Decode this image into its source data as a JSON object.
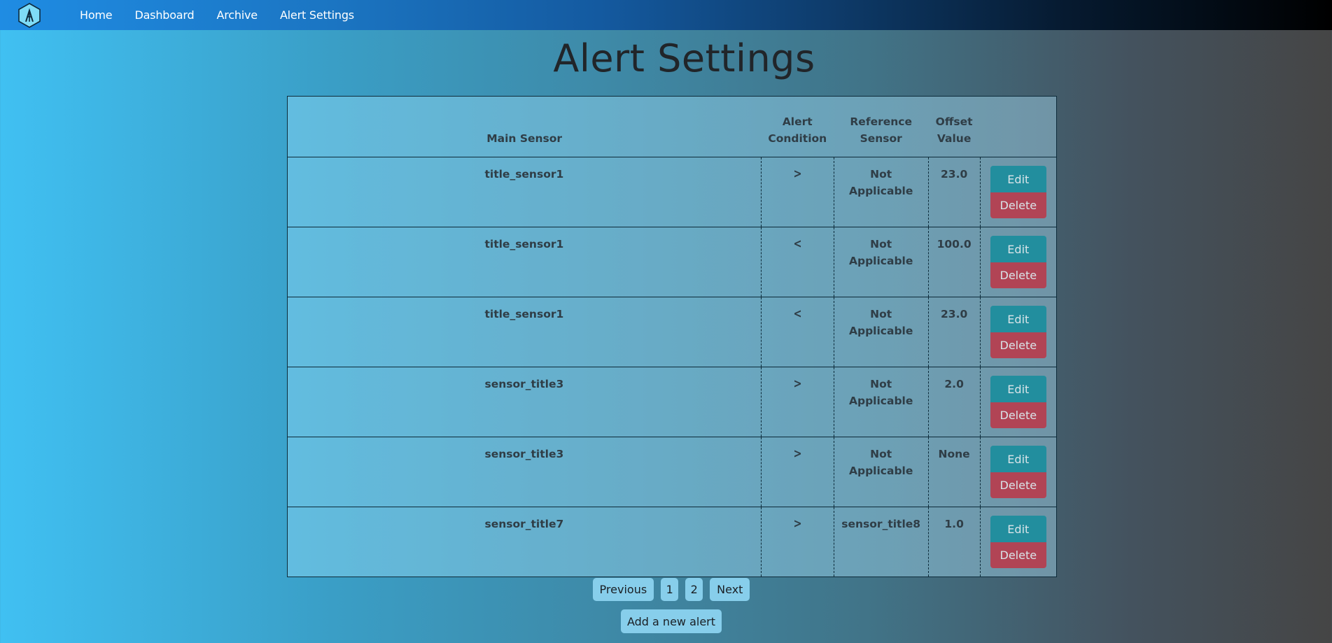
{
  "navbar": {
    "logo_icon": "hexagon-a-logo-icon",
    "links": [
      {
        "label": "Home"
      },
      {
        "label": "Dashboard"
      },
      {
        "label": "Archive"
      },
      {
        "label": "Alert Settings"
      }
    ]
  },
  "page": {
    "title": "Alert Settings"
  },
  "table": {
    "headers": {
      "main_sensor": "Main Sensor",
      "alert_condition": "Alert Condition",
      "reference_sensor": "Reference Sensor",
      "offset_value": "Offset Value",
      "actions": ""
    },
    "rows": [
      {
        "main_sensor": "title_sensor1",
        "condition": ">",
        "reference_sensor": "Not Applicable",
        "offset": "23.0",
        "edit_label": "Edit",
        "delete_label": "Delete"
      },
      {
        "main_sensor": "title_sensor1",
        "condition": "<",
        "reference_sensor": "Not Applicable",
        "offset": "100.0",
        "edit_label": "Edit",
        "delete_label": "Delete"
      },
      {
        "main_sensor": "title_sensor1",
        "condition": "<",
        "reference_sensor": "Not Applicable",
        "offset": "23.0",
        "edit_label": "Edit",
        "delete_label": "Delete"
      },
      {
        "main_sensor": "sensor_title3",
        "condition": ">",
        "reference_sensor": "Not Applicable",
        "offset": "2.0",
        "edit_label": "Edit",
        "delete_label": "Delete"
      },
      {
        "main_sensor": "sensor_title3",
        "condition": ">",
        "reference_sensor": "Not Applicable",
        "offset": "None",
        "edit_label": "Edit",
        "delete_label": "Delete"
      },
      {
        "main_sensor": "sensor_title7",
        "condition": ">",
        "reference_sensor": "sensor_title8",
        "offset": "1.0",
        "edit_label": "Edit",
        "delete_label": "Delete"
      }
    ]
  },
  "pagination": {
    "previous_label": "Previous",
    "pages": [
      "1",
      "2"
    ],
    "next_label": "Next"
  },
  "actions": {
    "add_label": "Add a new alert"
  },
  "colors": {
    "edit_button": "#228e9e",
    "delete_button": "#b14455",
    "pagination_button": "#87ceeb"
  }
}
